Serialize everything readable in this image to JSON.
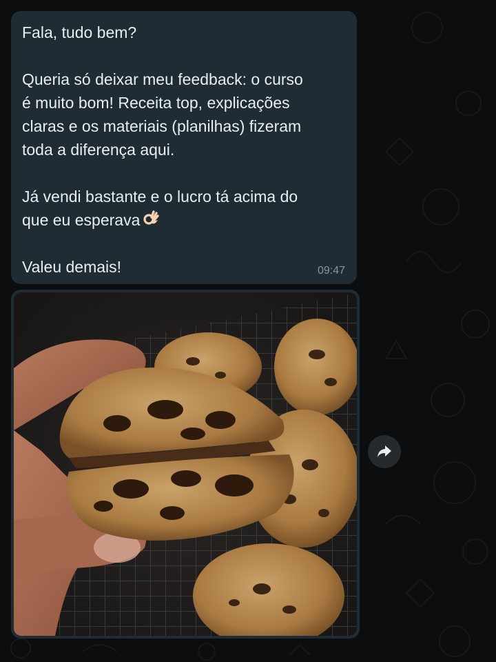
{
  "message": {
    "greeting": "Fala, tudo bem?",
    "paragraph1": "Queria só deixar meu feedback: o curso\né muito bom! Receita top, explicações\nclaras e os materiais (planilhas) fizeram\ntoda a diferença aqui.",
    "paragraph2": "Já vendi bastante e o lucro tá acima do\nque eu esperava",
    "emoji": "ok-hand-emoji",
    "closing": "Valeu demais!",
    "time": "09:47"
  },
  "media": {
    "kind": "photo",
    "subject": "chocolate-chip-cookies-on-cooling-rack"
  },
  "actions": {
    "forward_icon": "forward-arrow-icon"
  },
  "colors": {
    "background": "#0b0d0e",
    "bubble": "#1f2c34",
    "text": "#e9edef",
    "timestamp": "#8696a0",
    "forward_button": "#242a2e"
  }
}
